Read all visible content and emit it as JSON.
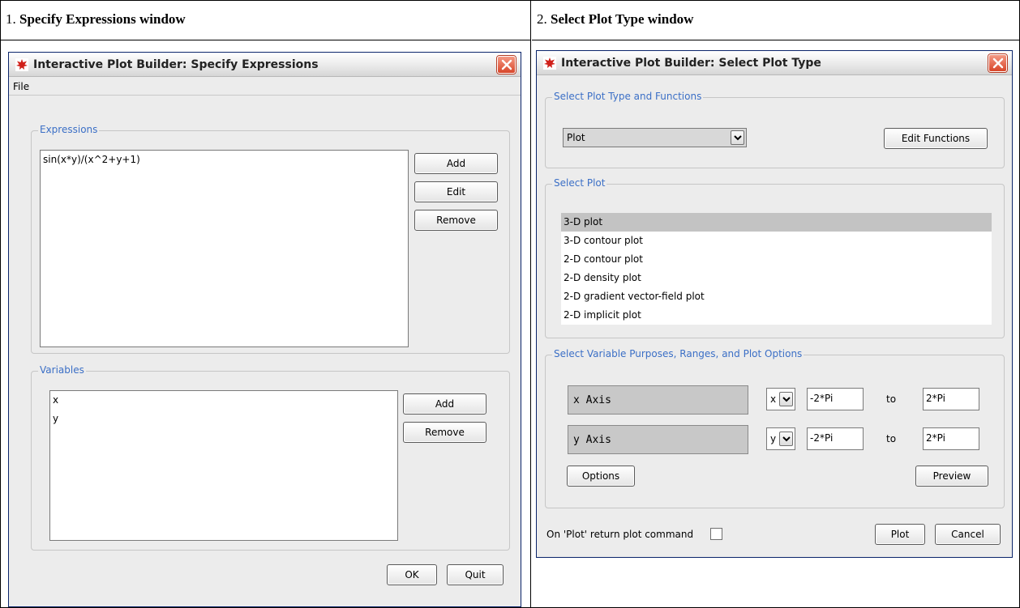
{
  "doc": {
    "col1_num": "1.",
    "col1_title": "Specify Expressions window",
    "col2_num": "2.",
    "col2_title": "Select Plot Type window"
  },
  "win1": {
    "title": "Interactive Plot Builder: Specify Expressions",
    "menu": {
      "file": "File"
    },
    "expressions": {
      "legend": "Expressions",
      "items": [
        "sin(x*y)/(x^2+y+1)"
      ],
      "add": "Add",
      "edit": "Edit",
      "remove": "Remove"
    },
    "variables": {
      "legend": "Variables",
      "items": [
        "x",
        "y"
      ],
      "add": "Add",
      "remove": "Remove"
    },
    "ok": "OK",
    "quit": "Quit"
  },
  "win2": {
    "title": "Interactive Plot Builder: Select Plot Type",
    "plot_type": {
      "legend": "Select Plot Type and Functions",
      "selected": "Plot",
      "edit_functions": "Edit Functions"
    },
    "select_plot": {
      "legend": "Select Plot",
      "items": [
        "3-D plot",
        "3-D contour plot",
        "2-D contour plot",
        "2-D density plot",
        "2-D gradient vector-field plot",
        "2-D implicit plot"
      ],
      "selected_index": 0
    },
    "variables": {
      "legend": "Select Variable Purposes, Ranges, and Plot Options",
      "rows": [
        {
          "label": "x Axis",
          "var": "x",
          "from": "-2*Pi",
          "to_label": "to",
          "to": "2*Pi"
        },
        {
          "label": "y Axis",
          "var": "y",
          "from": "-2*Pi",
          "to_label": "to",
          "to": "2*Pi"
        }
      ],
      "options": "Options",
      "preview": "Preview"
    },
    "return_cmd_label": "On 'Plot' return plot command",
    "plot": "Plot",
    "cancel": "Cancel"
  }
}
